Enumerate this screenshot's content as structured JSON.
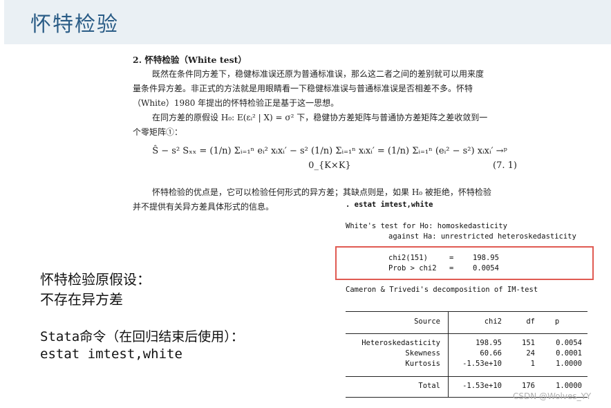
{
  "header": {
    "title": "怀特检验"
  },
  "book": {
    "section_title": "2. 怀特检验（White test）",
    "para1_line1": "既然在条件同方差下，稳健标准误还原为普通标准误，那么这二者之间的差别就可以用来度",
    "para1_line2": "量条件异方差。非正式的方法就是用眼睛看一下稳健标准误与普通标准误是否相差不多。怀特",
    "para1_line3": "（White）1980 年提出的怀特检验正是基于这一思想。",
    "para2_line1": "在同方差的原假设 H₀: E(εᵢ² | X) = σ² 下，稳健协方差矩阵与普通协方差矩阵之差收敛到一",
    "para2_line2": "个零矩阵①：",
    "equation": "Ŝ − s² Sₓₓ = (1/n) Σᵢ₌₁ⁿ eᵢ² xᵢxᵢ′ − s² (1/n) Σᵢ₌₁ⁿ xᵢxᵢ′ = (1/n) Σᵢ₌₁ⁿ (eᵢ² − s²) xᵢxᵢ′ →ᵖ 0_{K×K}",
    "equation_number": "(7. 1)",
    "para3_line1": "怀特检验的优点是，它可以检验任何形式的异方差；其缺点则是，如果 H₀ 被拒绝，怀特检验",
    "para3_line2": "并不提供有关异方差具体形式的信息。"
  },
  "stata": {
    "command": ". estat imtest,white",
    "h0_line": "White's test for Ho: homoskedasticity",
    "ha_line": "against Ha: unrestricted heteroskedasticity",
    "chi2_label": "chi2(151)",
    "chi2_eq": "=",
    "chi2_value": "198.95",
    "prob_label": "Prob > chi2",
    "prob_eq": "=",
    "prob_value": "0.0054",
    "decomp_title": "Cameron & Trivedi's decomposition of IM-test",
    "table": {
      "headers": [
        "Source",
        "chi2",
        "df",
        "p"
      ],
      "rows": [
        [
          "Heteroskedasticity",
          "198.95",
          "151",
          "0.0054"
        ],
        [
          "Skewness",
          "60.66",
          "24",
          "0.0001"
        ],
        [
          "Kurtosis",
          "-1.53e+10",
          "1",
          "1.0000"
        ]
      ],
      "total": [
        "Total",
        "-1.53e+10",
        "176",
        "1.0000"
      ]
    }
  },
  "notes": {
    "line1": "怀特检验原假设：",
    "line2": "不存在异方差",
    "line3": "Stata命令（在回归结束后使用）：",
    "line4": "estat imtest,white"
  },
  "watermark": "CSDN @Wolves_YY",
  "colors": {
    "header_bg": "#eaf0f4",
    "title": "#2a5c86",
    "highlight_border": "#e05a52"
  }
}
